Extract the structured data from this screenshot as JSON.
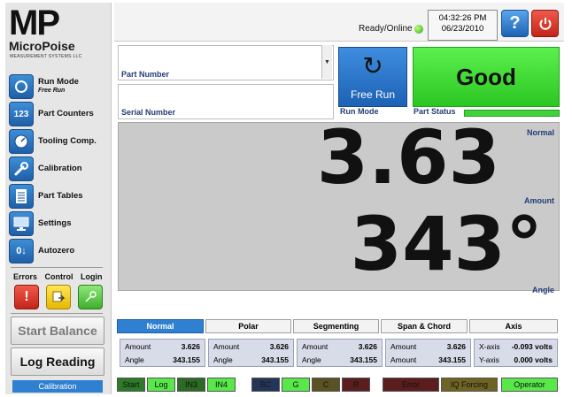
{
  "logo": {
    "brand_mp": "MP",
    "brand_name_a": "Micro",
    "brand_name_b": "Poise",
    "tagline": "MEASUREMENT SYSTEMS LLC"
  },
  "sidebar": {
    "items": [
      {
        "label": "Run Mode",
        "sub": "Free Run",
        "icon": "run-mode-icon"
      },
      {
        "label": "Part Counters",
        "icon": "counter-icon",
        "glyph": "123"
      },
      {
        "label": "Tooling Comp.",
        "icon": "tooling-gauge-icon"
      },
      {
        "label": "Calibration",
        "icon": "wrench-icon"
      },
      {
        "label": "Part Tables",
        "icon": "table-icon"
      },
      {
        "label": "Settings",
        "icon": "monitor-settings-icon"
      },
      {
        "label": "Autozero",
        "icon": "autozero-icon",
        "glyph": "0↓"
      }
    ],
    "errors_label": "Errors",
    "control_label": "Control",
    "login_label": "Login",
    "start_balance": "Start Balance",
    "log_reading": "Log Reading",
    "calibration_status": "Calibration"
  },
  "topbar": {
    "status": "Ready/Online",
    "time": "04:32:26 PM",
    "date": "06/23/2010",
    "help_glyph": "?",
    "status_color": "#2fa51c"
  },
  "part": {
    "part_number_label": "Part Number",
    "serial_number_label": "Serial Number",
    "run_mode_button": "Free Run",
    "run_mode_label": "Run Mode",
    "part_status_value": "Good",
    "part_status_label": "Part Status",
    "status_color": "#3fd33a"
  },
  "display": {
    "mode": "Normal",
    "amount_value": "3.63",
    "amount_label": "Amount",
    "angle_value": "343°",
    "angle_label": "Angle"
  },
  "tabs": [
    "Normal",
    "Polar",
    "Segmenting",
    "Span & Chord",
    "Axis"
  ],
  "readouts": [
    {
      "l1": "Amount",
      "v1": "3.626",
      "l2": "Angle",
      "v2": "343.155"
    },
    {
      "l1": "Amount",
      "v1": "3.626",
      "l2": "Angle",
      "v2": "343.155"
    },
    {
      "l1": "Amount",
      "v1": "3.626",
      "l2": "Angle",
      "v2": "343.155"
    },
    {
      "l1": "Amount",
      "v1": "3.626",
      "l2": "Amount",
      "v2": "343.155"
    },
    {
      "l1": "X-axis",
      "v1": "-0.093 volts",
      "l2": "Y-axis",
      "v2": "0.000 volts"
    }
  ],
  "leds": [
    {
      "label": "Start",
      "color": "#2d7a28",
      "text": "#111"
    },
    {
      "label": "Log",
      "color": "#58e84a",
      "text": "#111"
    },
    {
      "label": "IN3",
      "color": "#2c6b24",
      "text": "#111"
    },
    {
      "label": "IN4",
      "color": "#58e84a",
      "text": "#111"
    },
    {
      "label": "BC",
      "color": "#233558",
      "text": "#1a1a1a"
    },
    {
      "label": "G",
      "color": "#58e84a",
      "text": "#111"
    },
    {
      "label": "C",
      "color": "#5b5224",
      "text": "#111"
    },
    {
      "label": "R",
      "color": "#5b1d1d",
      "text": "#111"
    },
    {
      "label": "Error",
      "color": "#5b1d1d",
      "text": "#111"
    },
    {
      "label": "IQ Forcing",
      "color": "#6e6423",
      "text": "#111"
    },
    {
      "label": "Operator",
      "color": "#58e84a",
      "text": "#111"
    }
  ]
}
